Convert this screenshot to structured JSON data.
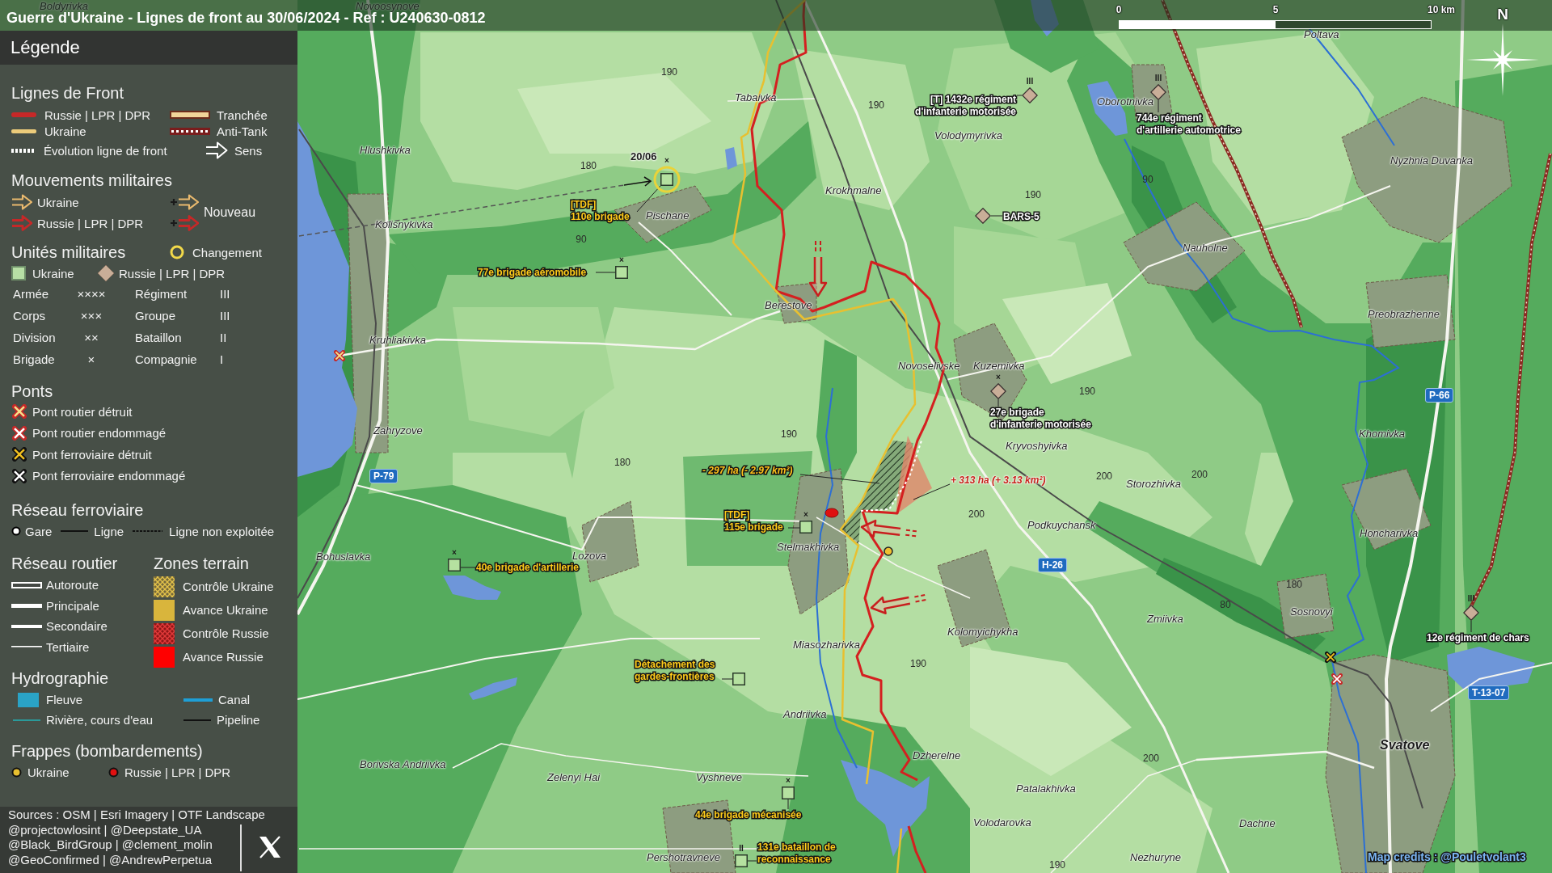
{
  "header": {
    "title": "Guerre d'Ukraine - Lignes de front au 30/06/2024 - Ref : U240630-0812",
    "scale": [
      "0",
      "5",
      "10 km"
    ],
    "north": "N"
  },
  "legend": {
    "title": "Légende",
    "front_lines": {
      "heading": "Lignes de Front",
      "items": [
        {
          "kind": "russia",
          "label": "Russie | LPR | DPR"
        },
        {
          "kind": "trench",
          "label": "Tranchée"
        },
        {
          "kind": "ukraine",
          "label": "Ukraine"
        },
        {
          "kind": "anti_tank",
          "label": "Anti-Tank"
        },
        {
          "kind": "evolution",
          "label": "Évolution ligne de front"
        },
        {
          "kind": "direction",
          "label": "Sens"
        }
      ]
    },
    "movements": {
      "heading": "Mouvements militaires",
      "items": [
        {
          "kind": "ukraine",
          "label": "Ukraine"
        },
        {
          "kind": "russia",
          "label": "Russie | LPR | DPR"
        }
      ],
      "new": {
        "label": "Nouveau",
        "items": [
          {
            "kind": "ukraine"
          },
          {
            "kind": "russia"
          }
        ]
      }
    },
    "units": {
      "heading": "Unités militaires",
      "change": {
        "label": "Changement"
      },
      "sides": [
        {
          "kind": "ukraine",
          "label": "Ukraine"
        },
        {
          "kind": "russia",
          "label": "Russie | LPR | DPR"
        }
      ],
      "echelons": [
        {
          "name": "Armée",
          "symbol": "××××"
        },
        {
          "name": "Régiment",
          "symbol": "III"
        },
        {
          "name": "Corps",
          "symbol": "×××"
        },
        {
          "name": "Groupe",
          "symbol": "III"
        },
        {
          "name": "Division",
          "symbol": "××"
        },
        {
          "name": "Bataillon",
          "symbol": "II"
        },
        {
          "name": "Brigade",
          "symbol": "×"
        },
        {
          "name": "Compagnie",
          "symbol": "I"
        }
      ]
    },
    "bridges": {
      "heading": "Ponts",
      "items": [
        {
          "kind": "road_destroyed",
          "label": "Pont routier détruit"
        },
        {
          "kind": "road_damaged",
          "label": "Pont routier endommagé"
        },
        {
          "kind": "rail_destroyed",
          "label": "Pont ferroviaire détruit"
        },
        {
          "kind": "rail_damaged",
          "label": "Pont ferroviaire endommagé"
        }
      ]
    },
    "railways": {
      "heading": "Réseau ferroviaire",
      "items": [
        {
          "kind": "station",
          "label": "Gare"
        },
        {
          "kind": "line",
          "label": "Ligne"
        },
        {
          "kind": "unused",
          "label": "Ligne non exploitée"
        }
      ]
    },
    "roads": {
      "heading": "Réseau routier",
      "items": [
        {
          "kind": "motorway",
          "label": "Autoroute"
        },
        {
          "kind": "primary",
          "label": "Principale"
        },
        {
          "kind": "secondary",
          "label": "Secondaire"
        },
        {
          "kind": "tertiary",
          "label": "Tertiaire"
        }
      ]
    },
    "zones": {
      "heading": "Zones terrain",
      "items": [
        {
          "kind": "ukraine_control",
          "label": "Contrôle Ukraine"
        },
        {
          "kind": "ukraine_advance",
          "label": "Avance Ukraine"
        },
        {
          "kind": "russia_control",
          "label": "Contrôle Russie"
        },
        {
          "kind": "russia_advance",
          "label": "Avance Russie"
        }
      ]
    },
    "hydro": {
      "heading": "Hydrographie",
      "items": [
        {
          "kind": "river_large",
          "label": "Fleuve"
        },
        {
          "kind": "canal",
          "label": "Canal"
        },
        {
          "kind": "stream",
          "label": "Rivière, cours d'eau"
        },
        {
          "kind": "pipeline",
          "label": "Pipeline"
        }
      ]
    },
    "strikes": {
      "heading": "Frappes (bombardements)",
      "items": [
        {
          "kind": "ukraine",
          "label": "Ukraine"
        },
        {
          "kind": "russia",
          "label": "Russie | LPR | DPR"
        }
      ]
    },
    "sources": [
      "Sources : OSM | Esri Imagery | OTF Landscape",
      "@projectowlosint | @Deepstate_UA",
      "@Black_BirdGroup | @clement_molin",
      "@GeoConfirmed | @AndrewPerpetua"
    ]
  },
  "map": {
    "places": [
      {
        "name": "Boldyrivka",
        "kind": "village"
      },
      {
        "name": "Novoosynove",
        "kind": "village"
      },
      {
        "name": "Poltava",
        "kind": "village"
      },
      {
        "name": "Tabaivka",
        "kind": "village"
      },
      {
        "name": "Oborotnivka",
        "kind": "village"
      },
      {
        "name": "Volodymyrivka",
        "kind": "village"
      },
      {
        "name": "Hlushkivka",
        "kind": "village"
      },
      {
        "name": "Nyzhnia Duvanka",
        "kind": "village"
      },
      {
        "name": "Krokhmalne",
        "kind": "village"
      },
      {
        "name": "Pischane",
        "kind": "village"
      },
      {
        "name": "Kolisnykivka",
        "kind": "village"
      },
      {
        "name": "Nauholne",
        "kind": "village"
      },
      {
        "name": "Berestove",
        "kind": "village"
      },
      {
        "name": "Preobrazhenne",
        "kind": "village"
      },
      {
        "name": "Kruhliakivka",
        "kind": "village"
      },
      {
        "name": "Novoselivske",
        "kind": "village"
      },
      {
        "name": "Kuzemivka",
        "kind": "village"
      },
      {
        "name": "Zahryzove",
        "kind": "village"
      },
      {
        "name": "Khomivka",
        "kind": "village"
      },
      {
        "name": "Kryvoshyivka",
        "kind": "village"
      },
      {
        "name": "Storozhivka",
        "kind": "village"
      },
      {
        "name": "Podkuychansk",
        "kind": "village"
      },
      {
        "name": "Honcharivka",
        "kind": "village"
      },
      {
        "name": "Stelmakhivka",
        "kind": "village"
      },
      {
        "name": "Bohuslavka",
        "kind": "village"
      },
      {
        "name": "Lozova",
        "kind": "village"
      },
      {
        "name": "Sosnovyi",
        "kind": "village"
      },
      {
        "name": "Zmiivka",
        "kind": "village"
      },
      {
        "name": "Kolomyichykha",
        "kind": "village"
      },
      {
        "name": "Miasozharivka",
        "kind": "village"
      },
      {
        "name": "Andriivka",
        "kind": "village"
      },
      {
        "name": "Svatove",
        "kind": "city"
      },
      {
        "name": "Dzherelne",
        "kind": "village"
      },
      {
        "name": "Borivska Andriivka",
        "kind": "village"
      },
      {
        "name": "Zelenyi Hai",
        "kind": "village"
      },
      {
        "name": "Vyshneve",
        "kind": "village"
      },
      {
        "name": "Patalakhivka",
        "kind": "village"
      },
      {
        "name": "Volodarovka",
        "kind": "village"
      },
      {
        "name": "Dachne",
        "kind": "village"
      },
      {
        "name": "Pershotravneve",
        "kind": "village"
      },
      {
        "name": "Nezhuryne",
        "kind": "village"
      }
    ],
    "elevations": [
      "190",
      "190",
      "180",
      "90",
      "190",
      "90",
      "190",
      "190",
      "180",
      "200",
      "200",
      "200",
      "180",
      "80",
      "190",
      "200",
      "190"
    ],
    "units": [
      {
        "kind": "russia",
        "echelon": "III",
        "lines": [
          "[T] 1432e régiment",
          "d'infanterie motorisée"
        ],
        "changed": false
      },
      {
        "kind": "russia",
        "echelon": "III",
        "lines": [
          "744e régiment",
          "d'artillerie automotrice"
        ],
        "changed": false
      },
      {
        "kind": "ukraine",
        "echelon": "×",
        "lines": [
          "[TDF]",
          "110e brigade"
        ],
        "changed": true,
        "date": "20/06"
      },
      {
        "kind": "russia",
        "lines": [
          "BARS-5"
        ],
        "changed": false
      },
      {
        "kind": "ukraine",
        "echelon": "×",
        "lines": [
          "77e brigade aéromobile"
        ],
        "changed": false
      },
      {
        "kind": "russia",
        "echelon": "×",
        "lines": [
          "27e brigade",
          "d'infanterie motorisée"
        ],
        "changed": false
      },
      {
        "kind": "ukraine",
        "echelon": "×",
        "lines": [
          "[TDF]",
          "115e brigade"
        ],
        "changed": false
      },
      {
        "kind": "ukraine",
        "echelon": "×",
        "lines": [
          "40e brigade d'artillerie"
        ],
        "changed": false
      },
      {
        "kind": "russia",
        "echelon": "III",
        "lines": [
          "12e régiment de chars"
        ],
        "changed": false
      },
      {
        "kind": "ukraine",
        "lines": [
          "Détachement des",
          "gardes-frontières"
        ],
        "changed": false
      },
      {
        "kind": "ukraine",
        "echelon": "×",
        "lines": [
          "44e brigade mécanisée"
        ],
        "changed": false
      },
      {
        "kind": "ukraine",
        "echelon": "II",
        "lines": [
          "131e bataillon de",
          "reconnaissance"
        ],
        "changed": false
      }
    ],
    "areas": [
      {
        "kind": "ukraine",
        "label": "- 297 ha (- 2.97 km²)"
      },
      {
        "kind": "russia",
        "label": "+ 313 ha (+ 3.13 km²)"
      }
    ],
    "strikes": [
      {
        "kind": "russia"
      },
      {
        "kind": "ukraine"
      }
    ],
    "bridges": [
      {
        "kind": "road_destroyed"
      },
      {
        "kind": "rail_destroyed"
      },
      {
        "kind": "road_damaged"
      }
    ],
    "roads": [
      "P-79",
      "P-66",
      "H-26",
      "T-13-07"
    ],
    "credits": "Map credits : @Pouletvolant3"
  }
}
